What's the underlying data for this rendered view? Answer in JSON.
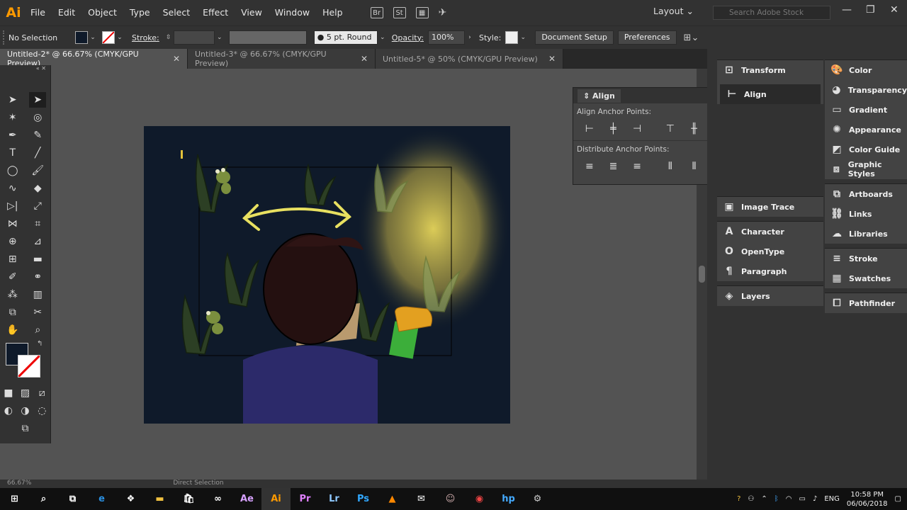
{
  "app": {
    "logo": "Ai",
    "menu": [
      "File",
      "Edit",
      "Object",
      "Type",
      "Select",
      "Effect",
      "View",
      "Window",
      "Help"
    ],
    "layout": "Layout",
    "search_placeholder": "Search Adobe Stock"
  },
  "control": {
    "selection": "No Selection",
    "stroke_label": "Stroke:",
    "brush": "5 pt. Round",
    "opacity_label": "Opacity:",
    "opacity": "100%",
    "style_label": "Style:",
    "doc_setup": "Document Setup",
    "preferences": "Preferences"
  },
  "tabs": [
    {
      "label": "Untitled-2* @ 66.67% (CMYK/GPU Preview)",
      "active": true
    },
    {
      "label": "Untitled-3* @ 66.67% (CMYK/GPU Preview)",
      "active": false
    },
    {
      "label": "Untitled-5* @ 50% (CMYK/GPU Preview)",
      "active": false
    }
  ],
  "align": {
    "title": "Align",
    "anchor_label": "Align Anchor Points:",
    "distribute_label": "Distribute Anchor Points:"
  },
  "panels_col1": [
    "Transform",
    "Align",
    "Image Trace",
    "Character",
    "OpenType",
    "Paragraph",
    "Layers"
  ],
  "panels_col2": [
    "Color",
    "Transparency",
    "Gradient",
    "Appearance",
    "Color Guide",
    "Graphic Styles",
    "Artboards",
    "Links",
    "Libraries",
    "Stroke",
    "Swatches",
    "Pathfinder"
  ],
  "status": {
    "zoom": "66.67%",
    "tool": "Direct Selection"
  },
  "tray": {
    "lang": "ENG",
    "time": "10:58 PM",
    "date": "06/06/2018"
  },
  "taskbar_apps": [
    "start",
    "search",
    "task-view",
    "edge",
    "dropbox",
    "explorer",
    "store",
    "infinity",
    "ae",
    "ai",
    "pr",
    "lr",
    "ps",
    "vlc",
    "mail",
    "photo",
    "chrome",
    "hp",
    "tool"
  ],
  "colors": {
    "accent": "#ff9a00",
    "artboard": "#0f1a2a"
  }
}
